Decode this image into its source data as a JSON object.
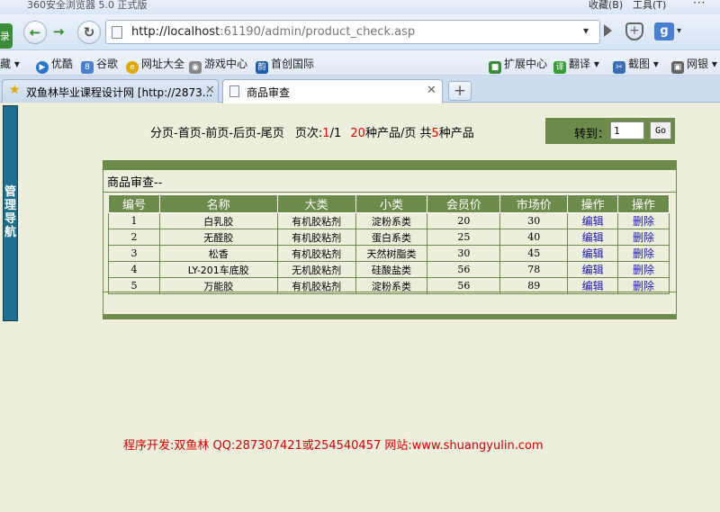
{
  "browser": {
    "title": "360安全浏览器 5.0 正式版",
    "menu_favorites": "收藏(B)",
    "menu_tools": "工具(T)",
    "login_label": "录",
    "url_host": "http://localhost",
    "url_rest": ":61190/admin/product_check.asp",
    "search_engine_icon": "g-icon"
  },
  "favbar": {
    "items": [
      "藏",
      "优酷",
      "谷歌",
      "网址大全",
      "游戏中心",
      "首创国际"
    ],
    "right_items": [
      "扩展中心",
      "翻译",
      "截图",
      "网银"
    ]
  },
  "tabs": [
    {
      "label": "双鱼林毕业课程设计网 [http://2873...",
      "active": false
    },
    {
      "label": "商品审查",
      "active": true
    }
  ],
  "sidenav": {
    "label": "管理导航"
  },
  "pager": {
    "nav_text": "分页-首页-前页-后页-尾页",
    "page_label": "页次:",
    "page_current": "1",
    "page_sep": "/",
    "page_total": "1",
    "per_page": "20",
    "per_page_suffix": "种产品/页 共",
    "total_count": "5",
    "total_suffix": "种产品"
  },
  "jump": {
    "label": "转到：",
    "value": "1",
    "button": "Go"
  },
  "panel": {
    "caption": "商品审查--"
  },
  "table": {
    "headers": [
      "编号",
      "名称",
      "大类",
      "小类",
      "会员价",
      "市场价",
      "操作",
      "操作"
    ],
    "rows": [
      {
        "id": "1",
        "name": "白乳胶",
        "category": "有机胶粘剂",
        "subcategory": "淀粉系类",
        "member_price": "20",
        "market_price": "30",
        "edit": "编辑",
        "delete": "删除"
      },
      {
        "id": "2",
        "name": "无醛胶",
        "category": "有机胶粘剂",
        "subcategory": "蛋白系类",
        "member_price": "25",
        "market_price": "40",
        "edit": "编辑",
        "delete": "删除"
      },
      {
        "id": "3",
        "name": "松香",
        "category": "有机胶粘剂",
        "subcategory": "天然树脂类",
        "member_price": "30",
        "market_price": "45",
        "edit": "编辑",
        "delete": "删除"
      },
      {
        "id": "4",
        "name": "LY-201车底胶",
        "category": "无机胶粘剂",
        "subcategory": "硅酸盐类",
        "member_price": "56",
        "market_price": "78",
        "edit": "编辑",
        "delete": "删除"
      },
      {
        "id": "5",
        "name": "万能胶",
        "category": "有机胶粘剂",
        "subcategory": "淀粉系类",
        "member_price": "56",
        "market_price": "89",
        "edit": "编辑",
        "delete": "删除"
      }
    ]
  },
  "footer": {
    "text": "程序开发:双鱼林 QQ:287307421或254540457 网站:www.shuangyulin.com"
  },
  "colors": {
    "accent_green": "#6c8a4a",
    "page_bg": "#eeeedd",
    "sidenav": "#1f6e8e",
    "highlight_red": "#e00000",
    "link_blue": "#1a1aa6"
  }
}
